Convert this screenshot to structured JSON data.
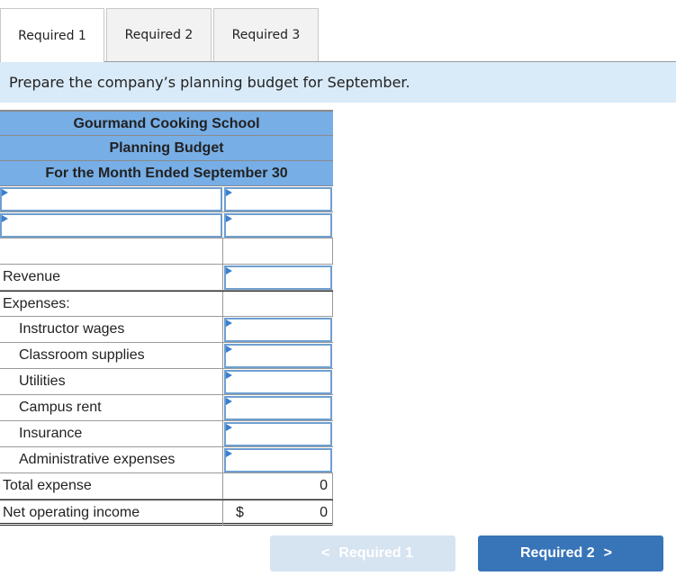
{
  "tabs": [
    {
      "label": "Required 1",
      "active": true
    },
    {
      "label": "Required 2",
      "active": false
    },
    {
      "label": "Required 3",
      "active": false
    }
  ],
  "instruction": "Prepare the company’s planning budget for September.",
  "budget": {
    "company": "Gourmand Cooking School",
    "title": "Planning Budget",
    "period": "For the Month Ended September 30",
    "input_rows": [
      {
        "label_value": "",
        "amount_value": ""
      },
      {
        "label_value": "",
        "amount_value": ""
      }
    ],
    "revenue": {
      "label": "Revenue",
      "value": ""
    },
    "expenses_label": "Expenses:",
    "expenses": [
      {
        "label": "Instructor wages",
        "value": ""
      },
      {
        "label": "Classroom supplies",
        "value": ""
      },
      {
        "label": "Utilities",
        "value": ""
      },
      {
        "label": "Campus rent",
        "value": ""
      },
      {
        "label": "Insurance",
        "value": ""
      },
      {
        "label": "Administrative expenses",
        "value": ""
      }
    ],
    "total_expense": {
      "label": "Total expense",
      "value": "0"
    },
    "net_operating_income": {
      "label": "Net operating income",
      "currency": "$",
      "value": "0"
    }
  },
  "nav": {
    "prev": {
      "label": "Required 1",
      "icon": "chevron-left-icon",
      "glyph": "<"
    },
    "next": {
      "label": "Required 2",
      "icon": "chevron-right-icon",
      "glyph": ">"
    }
  }
}
